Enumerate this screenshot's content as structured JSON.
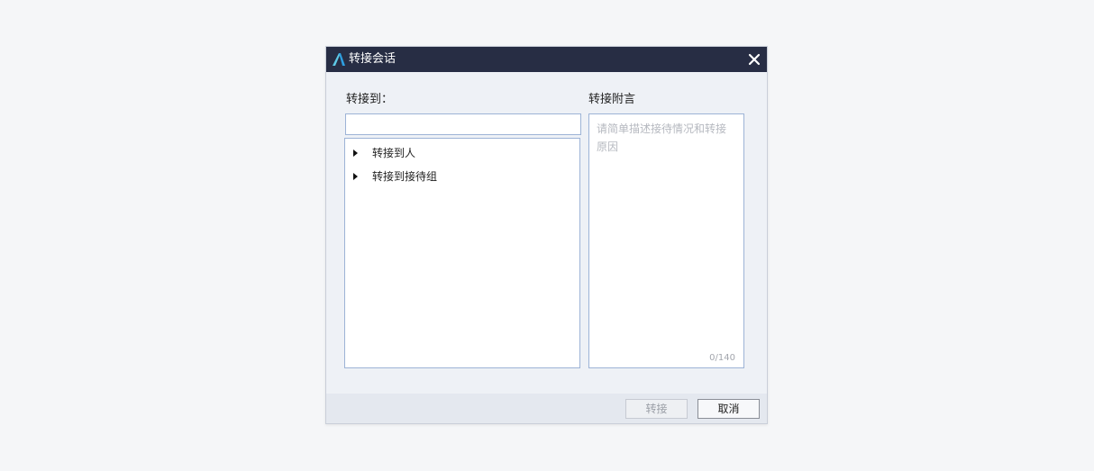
{
  "dialog": {
    "title": "转接会话",
    "close_icon": "close-icon",
    "logo_icon": "app-logo-icon",
    "accent_color": "#272d44"
  },
  "transfer": {
    "label": "转接到：",
    "search_value": "",
    "tree_items": [
      {
        "label": "转接到人",
        "icon": "caret-right-icon"
      },
      {
        "label": "转接到接待组",
        "icon": "caret-right-icon"
      }
    ]
  },
  "note": {
    "label": "转接附言",
    "placeholder": "请简单描述接待情况和转接原因",
    "counter": "0/140"
  },
  "footer": {
    "transfer_label": "转接",
    "cancel_label": "取消"
  }
}
